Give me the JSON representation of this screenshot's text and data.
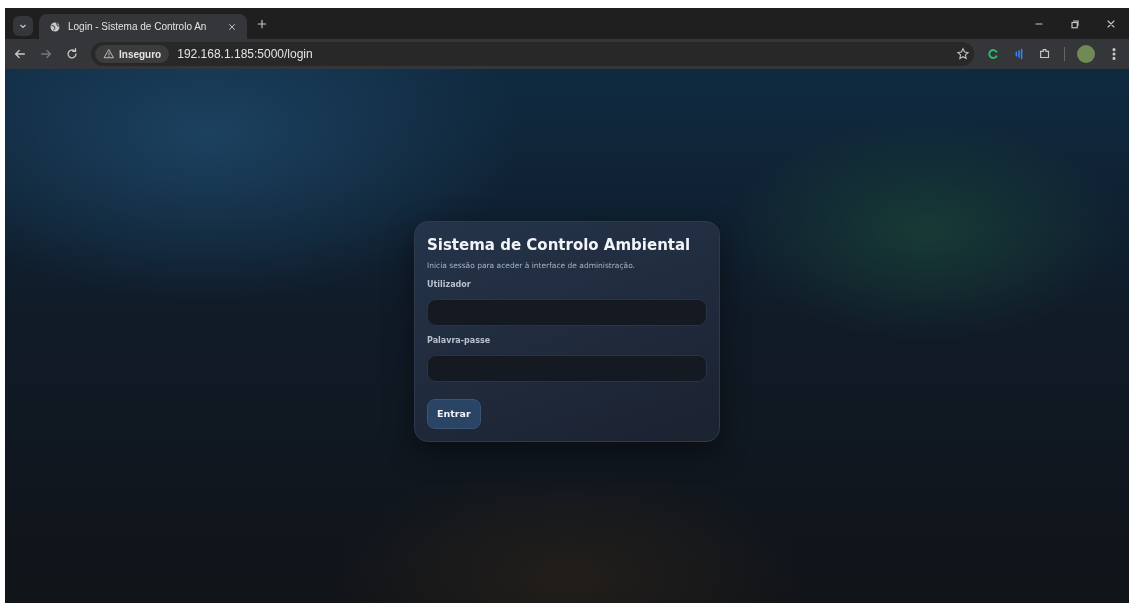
{
  "browser": {
    "tabs": [
      {
        "title": "Login - Sistema de Controlo An",
        "selected": true
      }
    ],
    "address": {
      "security_label": "Inseguro",
      "url": "192.168.1.185:5000/login"
    }
  },
  "login": {
    "title": "Sistema de Controlo Ambiental",
    "subtitle": "Inicia sessão para aceder à interface de administração.",
    "fields": [
      {
        "label": "Utilizador"
      },
      {
        "label": "Palavra-passe"
      }
    ],
    "button": "Entrar"
  }
}
